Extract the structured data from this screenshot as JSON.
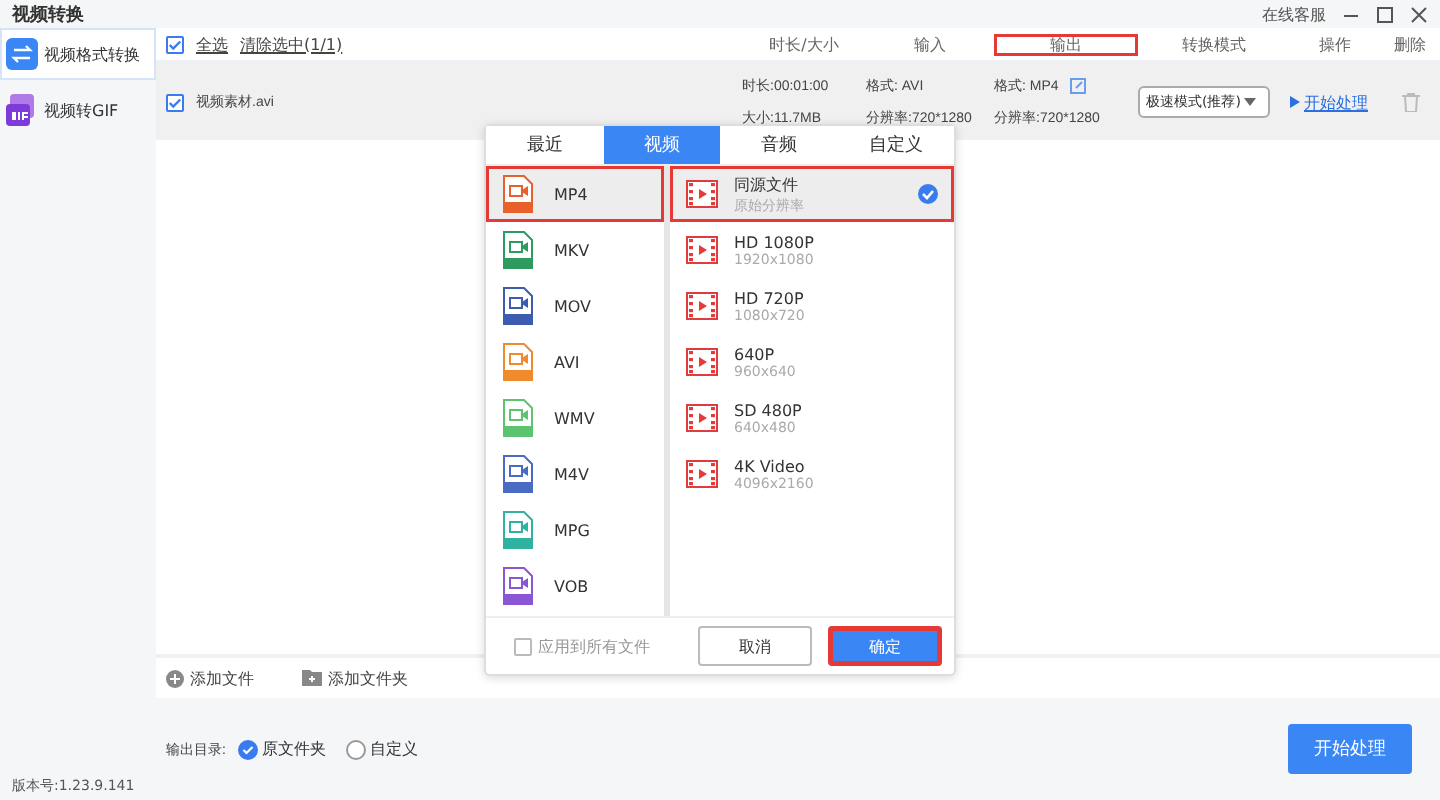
{
  "window": {
    "title": "视频转换",
    "service": "在线客服"
  },
  "sidebar": {
    "items": [
      {
        "label": "视频格式转换",
        "kind": "convert",
        "selected": true
      },
      {
        "label": "视频转GIF",
        "kind": "gif",
        "selected": false
      }
    ]
  },
  "list_header": {
    "select_all": {
      "label": "全选",
      "checked": true
    },
    "clear": "清除选中(1/1)",
    "columns": [
      {
        "label": "时长/大小",
        "highlighted": false
      },
      {
        "label": "输入",
        "highlighted": false
      },
      {
        "label": "输出",
        "highlighted": true
      },
      {
        "label": "转换模式",
        "highlighted": false
      },
      {
        "label": "操作",
        "highlighted": false
      },
      {
        "label": "删除",
        "highlighted": false
      }
    ]
  },
  "files": [
    {
      "name": "视频素材.avi",
      "checked": true,
      "duration": "时长:00:01:00",
      "size": "大小:11.7MB",
      "input_format": "格式: AVI",
      "input_resolution": "分辨率:720*1280",
      "output_format": "格式: MP4",
      "output_resolution": "分辨率:720*1280",
      "mode": "极速模式(推荐)",
      "action": "开始处理"
    }
  ],
  "format_popup": {
    "tabs": [
      {
        "label": "最近",
        "selected": false
      },
      {
        "label": "视频",
        "selected": true
      },
      {
        "label": "音频",
        "selected": false
      },
      {
        "label": "自定义",
        "selected": false
      }
    ],
    "formats": [
      {
        "label": "MP4",
        "color": "#e8612c",
        "selected": true,
        "highlighted": true
      },
      {
        "label": "MKV",
        "color": "#2e9b5e",
        "selected": false,
        "highlighted": false
      },
      {
        "label": "MOV",
        "color": "#3d5bb0",
        "selected": false,
        "highlighted": false
      },
      {
        "label": "AVI",
        "color": "#f08a2a",
        "selected": false,
        "highlighted": false
      },
      {
        "label": "WMV",
        "color": "#5cc46f",
        "selected": false,
        "highlighted": false
      },
      {
        "label": "M4V",
        "color": "#4a6bc4",
        "selected": false,
        "highlighted": false
      },
      {
        "label": "MPG",
        "color": "#2fb3a0",
        "selected": false,
        "highlighted": false
      },
      {
        "label": "VOB",
        "color": "#8a56d6",
        "selected": false,
        "highlighted": false
      }
    ],
    "presets": [
      {
        "title": "同源文件",
        "subtitle": "原始分辨率",
        "selected": true,
        "highlighted": true
      },
      {
        "title": "HD 1080P",
        "subtitle": "1920x1080",
        "selected": false,
        "highlighted": false
      },
      {
        "title": "HD 720P",
        "subtitle": "1080x720",
        "selected": false,
        "highlighted": false
      },
      {
        "title": "640P",
        "subtitle": "960x640",
        "selected": false,
        "highlighted": false
      },
      {
        "title": "SD 480P",
        "subtitle": "640x480",
        "selected": false,
        "highlighted": false
      },
      {
        "title": "4K Video",
        "subtitle": "4096x2160",
        "selected": false,
        "highlighted": false
      }
    ],
    "apply_all": {
      "label": "应用到所有文件",
      "checked": false
    },
    "cancel": "取消",
    "confirm": {
      "label": "确定",
      "highlighted": true
    }
  },
  "toolbar": [
    {
      "label": "添加文件",
      "kind": "file"
    },
    {
      "label": "添加文件夹",
      "kind": "folder"
    }
  ],
  "output_dir": {
    "label": "输出目录:",
    "options": [
      {
        "label": "原文件夹",
        "selected": true
      },
      {
        "label": "自定义",
        "selected": false
      }
    ]
  },
  "start_button": "开始处理",
  "version": "版本号:1.23.9.141"
}
